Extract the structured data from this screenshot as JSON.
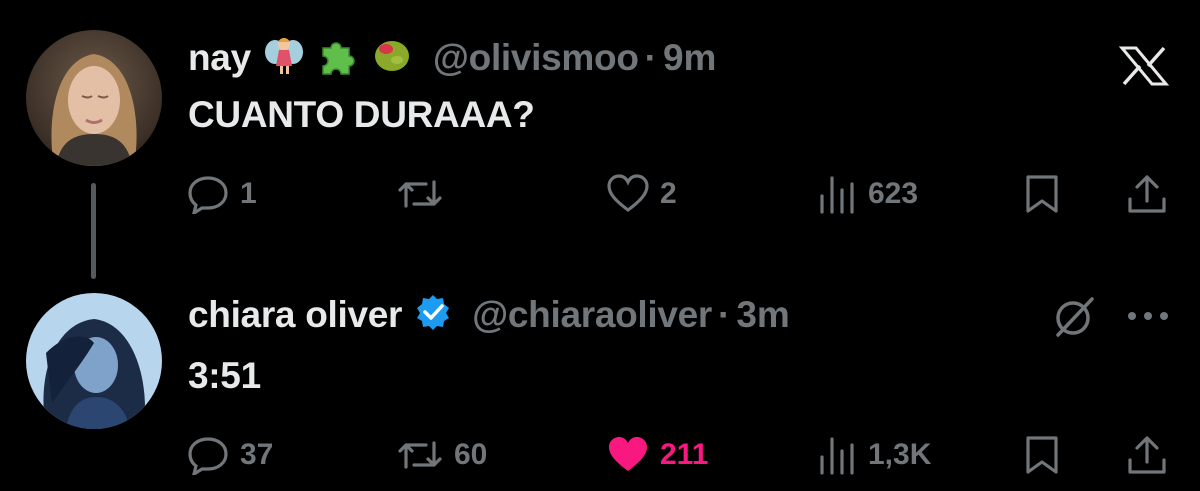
{
  "tweets": [
    {
      "name": "nay",
      "emojis": [
        "fairy-emoji",
        "puzzle-piece-emoji",
        "olive-emoji"
      ],
      "handle": "@olivismoo",
      "separator": "·",
      "time": "9m",
      "text": "CUANTO DURAAA?",
      "replies": "1",
      "retweets": "",
      "likes": "2",
      "views": "623",
      "liked": false,
      "top_right_icon": "x-logo-icon"
    },
    {
      "name": "chiara oliver",
      "verified": true,
      "handle": "@chiaraoliver",
      "separator": "·",
      "time": "3m",
      "text": "3:51",
      "replies": "37",
      "retweets": "60",
      "likes": "211",
      "views": "1,3K",
      "liked": true,
      "top_right_icons": [
        "grok-icon",
        "more-icon"
      ]
    }
  ],
  "colors": {
    "background": "#000000",
    "text": "#e7e9ea",
    "muted": "#71767b",
    "like": "#f91880",
    "verified": "#1d9bf0"
  }
}
